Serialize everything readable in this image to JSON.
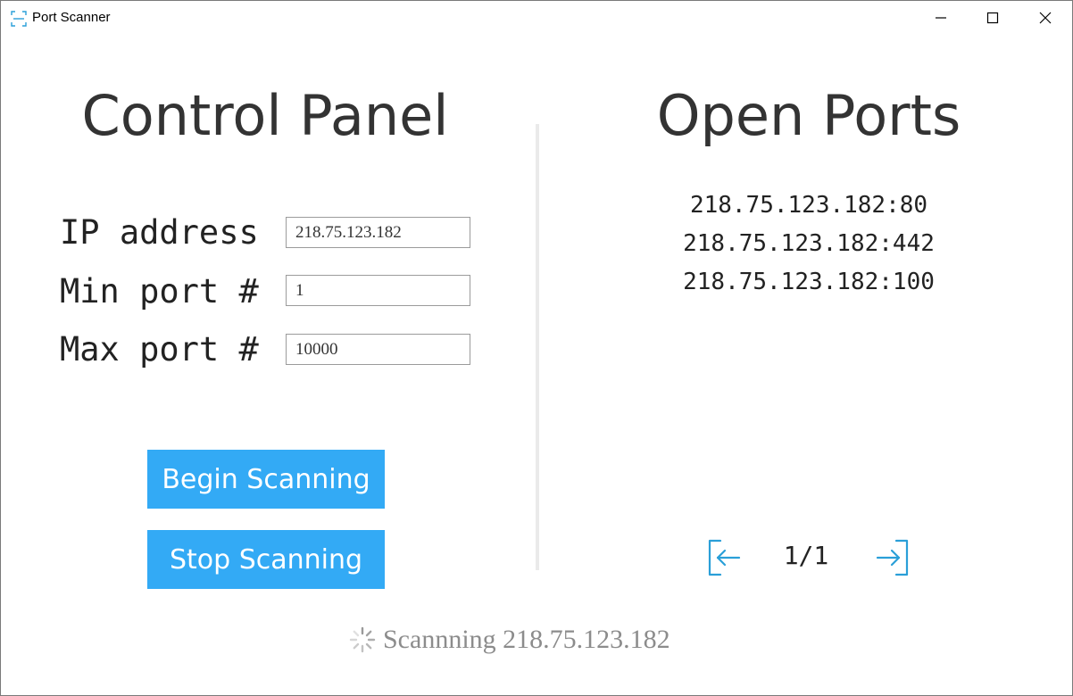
{
  "window": {
    "title": "Port Scanner",
    "app_icon": "scan-frame-icon",
    "controls": [
      "minimize-icon",
      "maximize-icon",
      "close-icon"
    ]
  },
  "control_panel": {
    "heading": "Control Panel",
    "fields": {
      "ip": {
        "label": "IP address",
        "value": "218.75.123.182"
      },
      "min_port": {
        "label": "Min port #",
        "value": "1"
      },
      "max_port": {
        "label": "Max port #",
        "value": "10000"
      }
    },
    "buttons": {
      "begin": "Begin Scanning",
      "stop": "Stop Scanning"
    }
  },
  "open_ports": {
    "heading": "Open Ports",
    "items": [
      "218.75.123.182:80",
      "218.75.123.182:442",
      "218.75.123.182:100"
    ],
    "pagination": {
      "page_label": "1/1",
      "prev_icon": "arrow-left-icon",
      "next_icon": "arrow-right-icon"
    }
  },
  "status": {
    "text": "Scannning 218.75.123.182",
    "icon": "loading-spinner-icon"
  },
  "colors": {
    "accent": "#33aaf5",
    "icon_blue": "#2a9fd8",
    "text": "#333333",
    "status_text": "#8c8c8c",
    "divider": "#eaeaea"
  }
}
